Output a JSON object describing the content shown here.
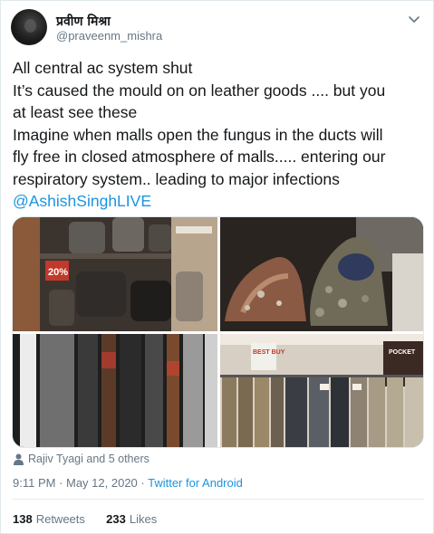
{
  "author": {
    "display_name": "प्रवीण मिश्रा",
    "handle": "@praveenm_mishra"
  },
  "tweet": {
    "lines": [
      "All central ac system shut",
      "It’s caused the mould on on leather goods .... but you",
      "at least see these",
      "Imagine when malls open the fungus in the ducts will",
      "fly free in closed atmosphere of malls..... entering our",
      "respiratory system.. leading to major infections"
    ],
    "mention": "@AshishSinghLIVE"
  },
  "media_signs": {
    "sale_sign": "20%",
    "best_buy": "BEST BUY",
    "brand_sign": "POCKET"
  },
  "likers": "Rajiv Tyagi and 5 others",
  "timestamp": "9:11 PM · May 12, 2020 · ",
  "source": "Twitter for Android",
  "stats": {
    "retweets_count": "138",
    "retweets_label": "Retweets",
    "likes_count": "233",
    "likes_label": "Likes"
  },
  "colors": {
    "link": "#1b95e0",
    "secondary_text": "#657786",
    "border": "#e1e8ed"
  }
}
